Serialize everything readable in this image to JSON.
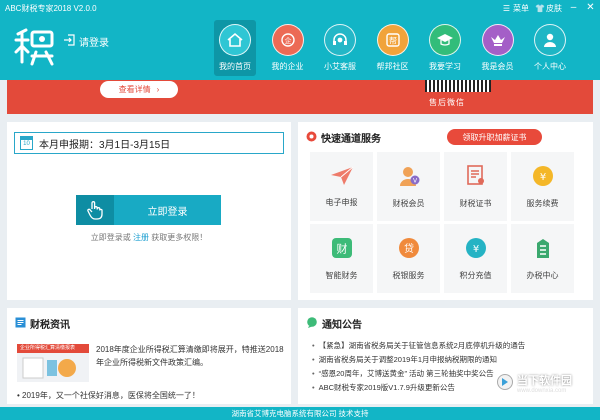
{
  "app": {
    "title": "ABC财税专家2018 V2.0.0"
  },
  "titlebar": {
    "menu_label": "菜单",
    "skin_label": "皮肤"
  },
  "header": {
    "login_label": "请登录"
  },
  "nav": [
    {
      "label": "我的首页",
      "icon": "home-icon"
    },
    {
      "label": "我的企业",
      "icon": "company-icon"
    },
    {
      "label": "小艾客服",
      "icon": "headset-icon"
    },
    {
      "label": "帮邦社区",
      "icon": "community-icon"
    },
    {
      "label": "我要学习",
      "icon": "graduation-cap-icon"
    },
    {
      "label": "我是会员",
      "icon": "crown-icon"
    },
    {
      "label": "个人中心",
      "icon": "user-icon"
    }
  ],
  "banner": {
    "button_label": "查看详情",
    "footer_text": "售后微信"
  },
  "period": {
    "title": "本月申报期：3月1日-3月15日",
    "calendar_day": "10"
  },
  "login_box": {
    "button_label": "立即登录",
    "hint_pre": "立即登录或",
    "hint_reg": "注册",
    "hint_post": "获取更多权限！"
  },
  "fast": {
    "title": "快速通道服务",
    "cert_tag": "领取升职加薪证书",
    "items": [
      {
        "label": "电子申报",
        "icon": "paper-plane-icon"
      },
      {
        "label": "财税会员",
        "icon": "member-icon"
      },
      {
        "label": "财税证书",
        "icon": "certificate-icon"
      },
      {
        "label": "服务续费",
        "icon": "money-bag-icon"
      },
      {
        "label": "智能财务",
        "icon": "finance-icon"
      },
      {
        "label": "税银服务",
        "icon": "loan-icon"
      },
      {
        "label": "积分充值",
        "icon": "coin-icon"
      },
      {
        "label": "办税中心",
        "icon": "building-icon"
      }
    ]
  },
  "news": {
    "title": "财税资讯",
    "thumb_caption": "企业所得税汇算清缴报表",
    "lead": "2018年度企业所得税汇算清缴即将展开，特推送2018年企业所得税新文件政策汇编。",
    "items": [
      "2019年，又一个社保好消息，医保将全国统一了！"
    ]
  },
  "notice": {
    "title": "通知公告",
    "items": [
      "【紧急】湖南省税务局关于征管信息系统2月底停机升级的通告",
      "湖南省税务局关于调整2019年1月申报纳税期限的通知",
      "“感恩20周年，艾博送黄金” 活动 第三轮抽奖中奖公告",
      "ABC财税专家2019版V1.7.9升级更新公告"
    ]
  },
  "watermark": {
    "text": "当下软件园",
    "sub": "www.downxia.com"
  },
  "footer": {
    "text": "湖南省艾博克电脑系统有限公司 技术支持"
  },
  "colors": {
    "header": "#12b5c6",
    "accent_red": "#e34a3a",
    "nav_active": "#0e96a6"
  }
}
